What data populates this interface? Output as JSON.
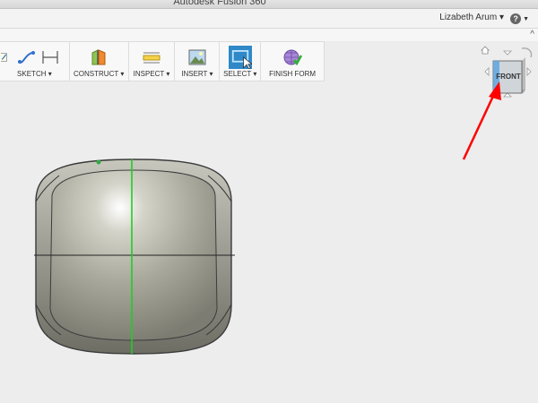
{
  "window": {
    "title": "Autodesk Fusion 360"
  },
  "header": {
    "user_name": "Lizabeth Arum ▾",
    "help_icon": "question-circle-icon"
  },
  "toolbar": {
    "groups": [
      {
        "label": "SKETCH ▾"
      },
      {
        "label": "CONSTRUCT ▾"
      },
      {
        "label": "INSPECT ▾"
      },
      {
        "label": "INSERT ▾"
      },
      {
        "label": "SELECT ▾"
      },
      {
        "label": "FINISH FORM"
      }
    ]
  },
  "viewcube": {
    "face_label": "FRONT"
  },
  "colors": {
    "accent": "#2f88c8",
    "selection_line": "#22cc22",
    "annotation_arrow": "#ff0000",
    "body_fill": "#a8a79b"
  }
}
